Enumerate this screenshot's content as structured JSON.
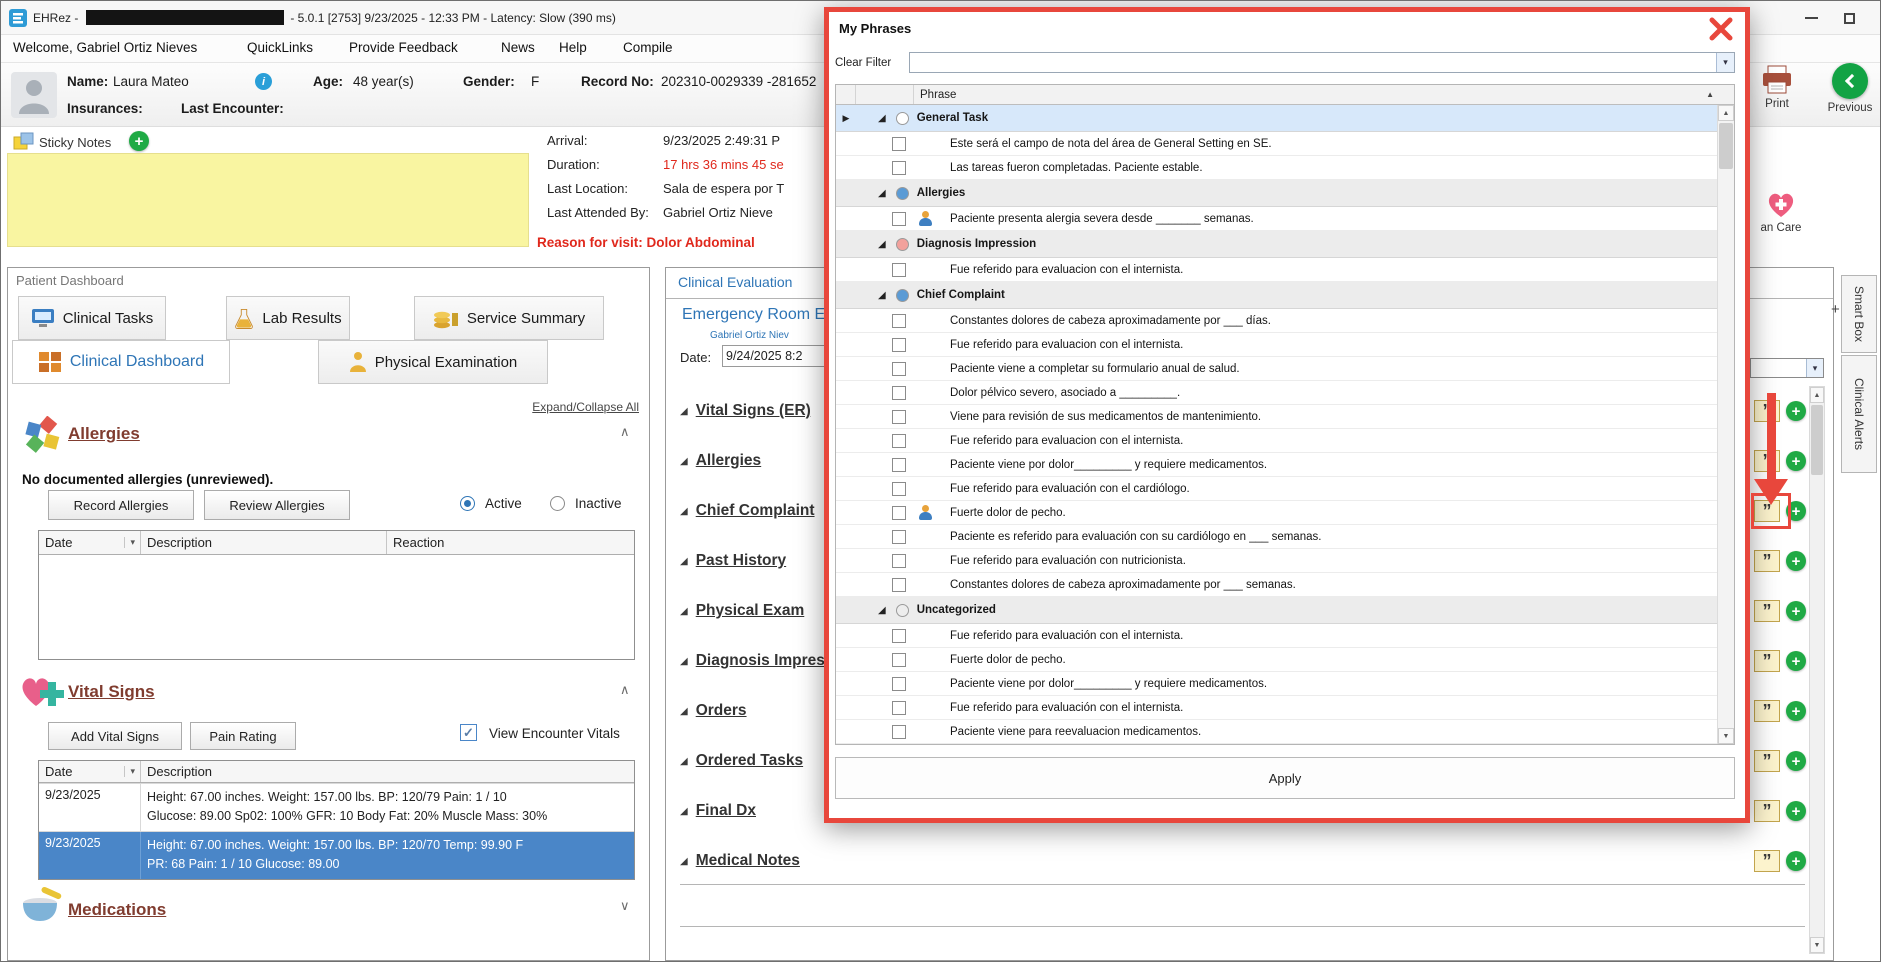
{
  "colors": {
    "annotation_red": "#e8473c",
    "accent_blue": "#2e75b6",
    "selected_row_blue": "#4a86c8",
    "plus_green": "#1faa45",
    "alert_red": "#e0281c"
  },
  "icons": {
    "row_marker": "▶",
    "expander": "◢",
    "sort_asc": "▲",
    "dropdown": "▾",
    "chevron_up": "∧",
    "chevron_down": "∨",
    "quote": "”",
    "plus": "+",
    "check": "✓",
    "scroll_up": "▲",
    "scroll_down": "▼",
    "info": "i"
  },
  "titlebar": {
    "app_name": "EHRez -",
    "version_info": "- 5.0.1 [2753] 9/23/2025 - 12:33 PM - Latency: Slow (390 ms)"
  },
  "menubar": {
    "items": [
      "Welcome, Gabriel Ortiz Nieves",
      "QuickLinks",
      "Provide Feedback",
      "News",
      "Help",
      "Compile"
    ]
  },
  "patient": {
    "name_label": "Name:",
    "name": "Laura Mateo",
    "age_label": "Age:",
    "age": "48 year(s)",
    "gender_label": "Gender:",
    "gender": "F",
    "record_label": "Record No:",
    "record_no": "202310-0029339 -281652",
    "insurances_label": "Insurances:",
    "last_encounter_label": "Last Encounter:"
  },
  "sticky_notes": {
    "label": "Sticky Notes"
  },
  "encounter": {
    "arrival_label": "Arrival:",
    "arrival_value": "9/23/2025 2:49:31 P",
    "duration_label": "Duration:",
    "duration_value": "17 hrs 36 mins 45 se",
    "last_location_label": "Last Location:",
    "last_location_value": "Sala de espera por T",
    "last_attended_label": "Last Attended By:",
    "last_attended_value": "Gabriel Ortiz Nieve",
    "reason_text": "Reason for visit: Dolor Abdominal"
  },
  "toolbar": {
    "print_label": "Print",
    "previous_label": "Previous",
    "care_label": "an Care"
  },
  "side_tabs": {
    "add_tab": "+",
    "smart_box": "Smart Box",
    "clinical_alerts": "Clinical Alerts"
  },
  "dashboard": {
    "title": "Patient Dashboard",
    "tab_clinical_tasks": "Clinical Tasks",
    "tab_lab_results": "Lab Results",
    "tab_service_summary": "Service Summary",
    "tab_clinical_dashboard": "Clinical Dashboard",
    "tab_physical_examination": "Physical Examination",
    "expand_collapse": "Expand/Collapse All",
    "allergies": {
      "title": "Allergies",
      "status": "No documented allergies (unreviewed).",
      "record_button": "Record Allergies",
      "review_button": "Review Allergies",
      "radio_active": "Active",
      "radio_inactive": "Inactive",
      "col_date": "Date",
      "col_description": "Description",
      "col_reaction": "Reaction"
    },
    "vitals": {
      "title": "Vital Signs",
      "add_button": "Add Vital Signs",
      "pain_button": "Pain Rating",
      "view_checkbox": "View Encounter Vitals",
      "col_date": "Date",
      "col_description": "Description",
      "rows": [
        {
          "date": "9/23/2025",
          "line1": "Height: 67.00 inches. Weight: 157.00 lbs. BP: 120/79 Pain: 1 / 10",
          "line2": "Glucose: 89.00 Sp02: 100% GFR: 10 Body Fat: 20% Muscle Mass: 30%"
        },
        {
          "date": "9/23/2025",
          "line1": "Height: 67.00 inches. Weight: 157.00 lbs. BP: 120/70 Temp: 99.90 F",
          "line2": "PR: 68 Pain: 1 / 10 Glucose: 89.00"
        }
      ]
    },
    "medications": {
      "title": "Medications"
    }
  },
  "evaluation": {
    "tab_title": "Clinical Evaluation",
    "note_title": "Emergency Room E",
    "author": "Gabriel Ortiz Niev",
    "date_label": "Date:",
    "date_value": "9/24/2025 8:2",
    "sections": [
      "Vital Signs (ER)",
      "Allergies",
      "Chief Complaint",
      "Past History",
      "Physical Exam",
      "Diagnosis Impres",
      "Orders",
      "Ordered Tasks",
      "Final Dx",
      "Medical Notes"
    ]
  },
  "phrases_dialog": {
    "title": "My Phrases",
    "clear_filter_label": "Clear Filter",
    "phrase_column": "Phrase",
    "apply_label": "Apply",
    "groups": [
      {
        "name": "General Task",
        "dot_color": "#ffffff",
        "selected": true,
        "items": [
          {
            "text": "Este será el campo de nota del área de General Setting en SE.",
            "icon": false
          },
          {
            "text": "Las tareas fueron completadas. Paciente estable.",
            "icon": false
          }
        ]
      },
      {
        "name": "Allergies",
        "dot_color": "#5b9bd5",
        "selected": false,
        "items": [
          {
            "text": "Paciente presenta alergia severa desde _______ semanas.",
            "icon": true
          }
        ]
      },
      {
        "name": "Diagnosis Impression",
        "dot_color": "#f2a19c",
        "selected": false,
        "items": [
          {
            "text": "Fue referido para evaluacion con el internista.",
            "icon": false
          }
        ]
      },
      {
        "name": "Chief Complaint",
        "dot_color": "#5b9bd5",
        "selected": false,
        "items": [
          {
            "text": "Constantes dolores de cabeza aproximadamente por ___ días.",
            "icon": false
          },
          {
            "text": "Fue referido para evaluacion con el internista.",
            "icon": false
          },
          {
            "text": "Paciente viene a completar su formulario anual de salud.",
            "icon": false
          },
          {
            "text": "Dolor pélvico severo, asociado a _________.",
            "icon": false
          },
          {
            "text": "Viene para revisión de sus medicamentos de mantenimiento.",
            "icon": false
          },
          {
            "text": "Fue referido para evaluacion con el internista.",
            "icon": false
          },
          {
            "text": "Paciente viene por dolor_________ y requiere medicamentos.",
            "icon": false
          },
          {
            "text": "Fue referido para evaluación con el cardiólogo.",
            "icon": false
          },
          {
            "text": "Fuerte dolor de pecho.",
            "icon": true
          },
          {
            "text": "Paciente es referido para evaluación con su cardiólogo en ___ semanas.",
            "icon": false
          },
          {
            "text": "Fue referido para evaluación con nutricionista.",
            "icon": false
          },
          {
            "text": "Constantes dolores de cabeza aproximadamente por ___ semanas.",
            "icon": false
          }
        ]
      },
      {
        "name": "Uncategorized",
        "dot_color": "#ededed",
        "selected": false,
        "items": [
          {
            "text": "Fue referido para evaluación con el internista.",
            "icon": false
          },
          {
            "text": "Fuerte dolor de pecho.",
            "icon": false
          },
          {
            "text": "Paciente viene por dolor_________ y requiere medicamentos.",
            "icon": false
          },
          {
            "text": "Fue referido para evaluación con el internista.",
            "icon": false
          },
          {
            "text": "Paciente viene para reevaluacion medicamentos.",
            "icon": false
          }
        ]
      }
    ]
  }
}
